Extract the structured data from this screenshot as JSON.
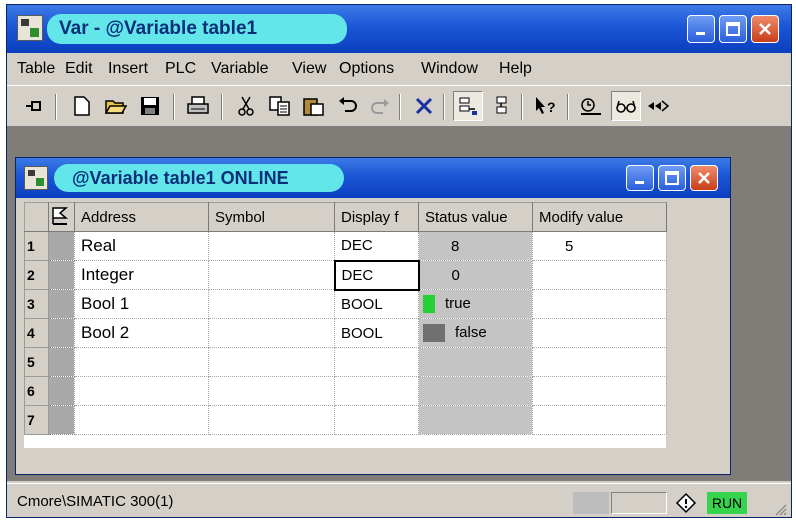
{
  "window": {
    "title": "Var - @Variable table1"
  },
  "menu": {
    "items": [
      "Table",
      "Edit",
      "Insert",
      "PLC",
      "Variable",
      "View",
      "Options",
      "Window",
      "Help"
    ]
  },
  "toolbar": {
    "icons": [
      "pin-icon",
      "new-icon",
      "open-icon",
      "save-icon",
      "print-icon",
      "cut-icon",
      "copy-icon",
      "paste-icon",
      "undo-icon",
      "redo-icon",
      "delete-icon",
      "monitor-variable-icon",
      "modify-variable-icon",
      "context-help-icon",
      "trigger-icon",
      "glasses-icon",
      "send-icon"
    ]
  },
  "child_window": {
    "title": "@Variable table1  ONLINE"
  },
  "table": {
    "headers": {
      "address": "Address",
      "symbol": "Symbol",
      "display": "Display f",
      "status": "Status value",
      "modify": "Modify value"
    },
    "rows": [
      {
        "num": "1",
        "address": "Real",
        "symbol": "",
        "display": "DEC",
        "status": "8",
        "modify": "5"
      },
      {
        "num": "2",
        "address": "Integer",
        "symbol": "",
        "display": "DEC",
        "status": "0",
        "modify": ""
      },
      {
        "num": "3",
        "address": "Bool 1",
        "symbol": "",
        "display": "BOOL",
        "status": "true",
        "modify": ""
      },
      {
        "num": "4",
        "address": "Bool 2",
        "symbol": "",
        "display": "BOOL",
        "status": "false",
        "modify": ""
      },
      {
        "num": "5",
        "address": "",
        "symbol": "",
        "display": "",
        "status": "",
        "modify": ""
      },
      {
        "num": "6",
        "address": "",
        "symbol": "",
        "display": "",
        "status": "",
        "modify": ""
      },
      {
        "num": "7",
        "address": "",
        "symbol": "",
        "display": "",
        "status": "",
        "modify": ""
      }
    ]
  },
  "colors": {
    "true_indicator": "#22d133",
    "false_indicator": "#707070",
    "run_status": "#35d44c",
    "title_gradient": "#1b56d6",
    "title_pill": "#63e6e9"
  },
  "statusbar": {
    "text": "Cmore\\SIMATIC 300(1)",
    "run": "RUN"
  }
}
